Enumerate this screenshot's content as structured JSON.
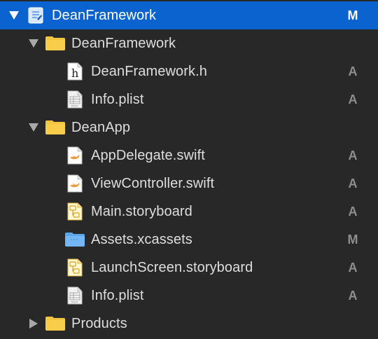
{
  "colors": {
    "background": "#282828",
    "selection": "#0b63cf",
    "folder_yellow": "#f5c542",
    "folder_blue": "#6fb2f2",
    "status_gray": "#8e8e8e",
    "swift_orange": "#f0973c"
  },
  "project": {
    "label": "DeanFramework",
    "status": "M",
    "icon": "xcode-project-icon"
  },
  "groups": [
    {
      "label": "DeanFramework",
      "icon": "folder-icon",
      "expanded": true,
      "files": [
        {
          "label": "DeanFramework.h",
          "status": "A",
          "icon": "header-file-icon"
        },
        {
          "label": "Info.plist",
          "status": "A",
          "icon": "plist-file-icon"
        }
      ]
    },
    {
      "label": "DeanApp",
      "icon": "folder-icon",
      "expanded": true,
      "files": [
        {
          "label": "AppDelegate.swift",
          "status": "A",
          "icon": "swift-file-icon"
        },
        {
          "label": "ViewController.swift",
          "status": "A",
          "icon": "swift-file-icon"
        },
        {
          "label": "Main.storyboard",
          "status": "A",
          "icon": "storyboard-file-icon"
        },
        {
          "label": "Assets.xcassets",
          "status": "M",
          "icon": "asset-catalog-folder-icon"
        },
        {
          "label": "LaunchScreen.storyboard",
          "status": "A",
          "icon": "storyboard-file-icon"
        },
        {
          "label": "Info.plist",
          "status": "A",
          "icon": "plist-file-icon"
        }
      ]
    },
    {
      "label": "Products",
      "icon": "folder-icon",
      "expanded": false,
      "files": []
    }
  ]
}
